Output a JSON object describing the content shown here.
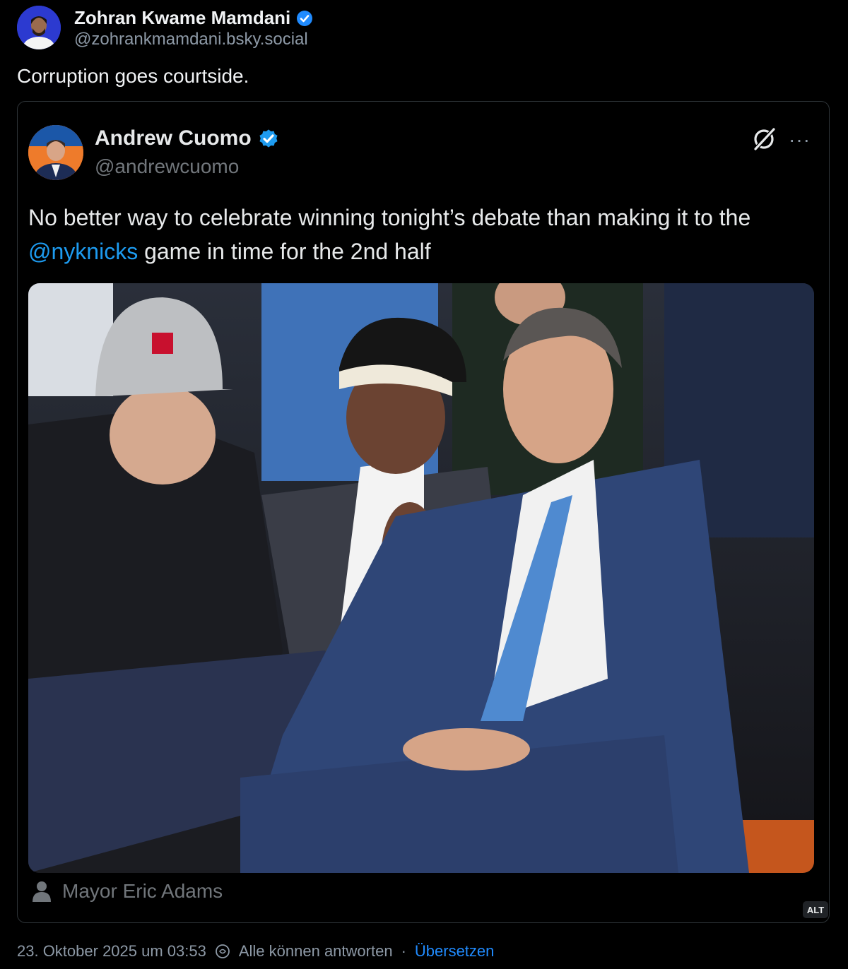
{
  "post": {
    "author_name": "Zohran Kwame Mamdani",
    "author_handle": "@zohrankmamdani.bsky.social",
    "text": "Corruption goes courtside.",
    "avatar_icon": "profile-photo",
    "verified_icon": "verified-badge-icon"
  },
  "embed": {
    "author_name": "Andrew Cuomo",
    "author_handle": "@andrewcuomo",
    "text_before": "No better way to celebrate winning tonight’s debate than making it to the",
    "mention": "@nyknicks",
    "text_after": " game in time for the 2nd half",
    "photo_tag": "Mayor Eric Adams",
    "alt_badge": "ALT",
    "more_icon": "···"
  },
  "footer": {
    "timestamp": "23. Oktober 2025 um 03:53",
    "reply_setting": "Alle können antworten",
    "separator": "·",
    "translate": "Übersetzen"
  },
  "colors": {
    "background": "#000000",
    "accent": "#208bfe",
    "verified": "#1d9bf0",
    "muted": "#8d99a6"
  }
}
